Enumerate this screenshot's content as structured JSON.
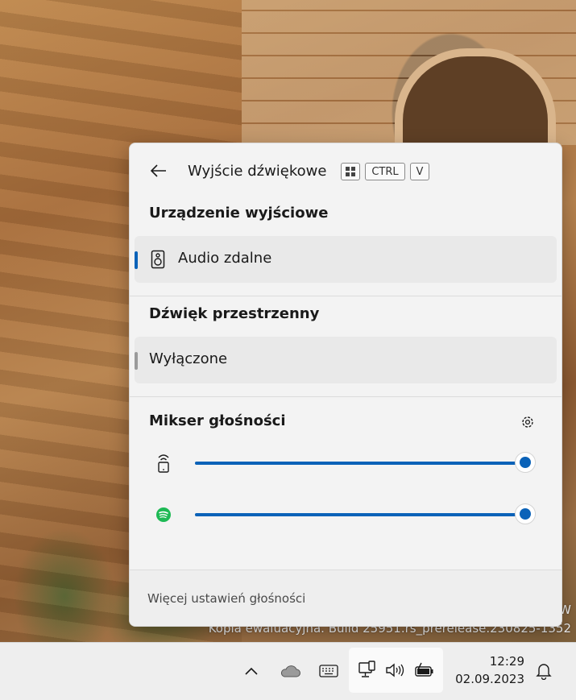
{
  "flyout": {
    "header": {
      "title": "Wyjście dźwiękowe",
      "shortcut_keys": [
        "CTRL",
        "V"
      ]
    },
    "output_section": {
      "title": "Urządzenie wyjściowe",
      "selected_device": "Audio zdalne",
      "indicator_color": "#0a62b8"
    },
    "spatial_section": {
      "title": "Dźwięk przestrzenny",
      "selected_option": "Wyłączone",
      "indicator_color": "#9a9a9a"
    },
    "mixer": {
      "title": "Mikser głośności",
      "apps": [
        {
          "icon": "remote-device-icon",
          "volume": 100
        },
        {
          "icon": "spotify-icon",
          "volume": 100
        }
      ]
    },
    "footer": {
      "link": "Więcej ustawień głośności"
    }
  },
  "watermark": {
    "line1": "W",
    "line2": "Kopia ewaluacyjna. Build 25951.rs_prerelease.230825-1352"
  },
  "taskbar": {
    "time": "12:29",
    "date": "02.09.2023",
    "tray_icons": [
      "chevron-up-icon",
      "onedrive-icon",
      "keyboard-icon",
      "network-icon",
      "volume-icon",
      "battery-icon",
      "notification-bell-icon"
    ]
  },
  "colors": {
    "accent": "#0a62b8",
    "surface": "#f3f3f3"
  }
}
